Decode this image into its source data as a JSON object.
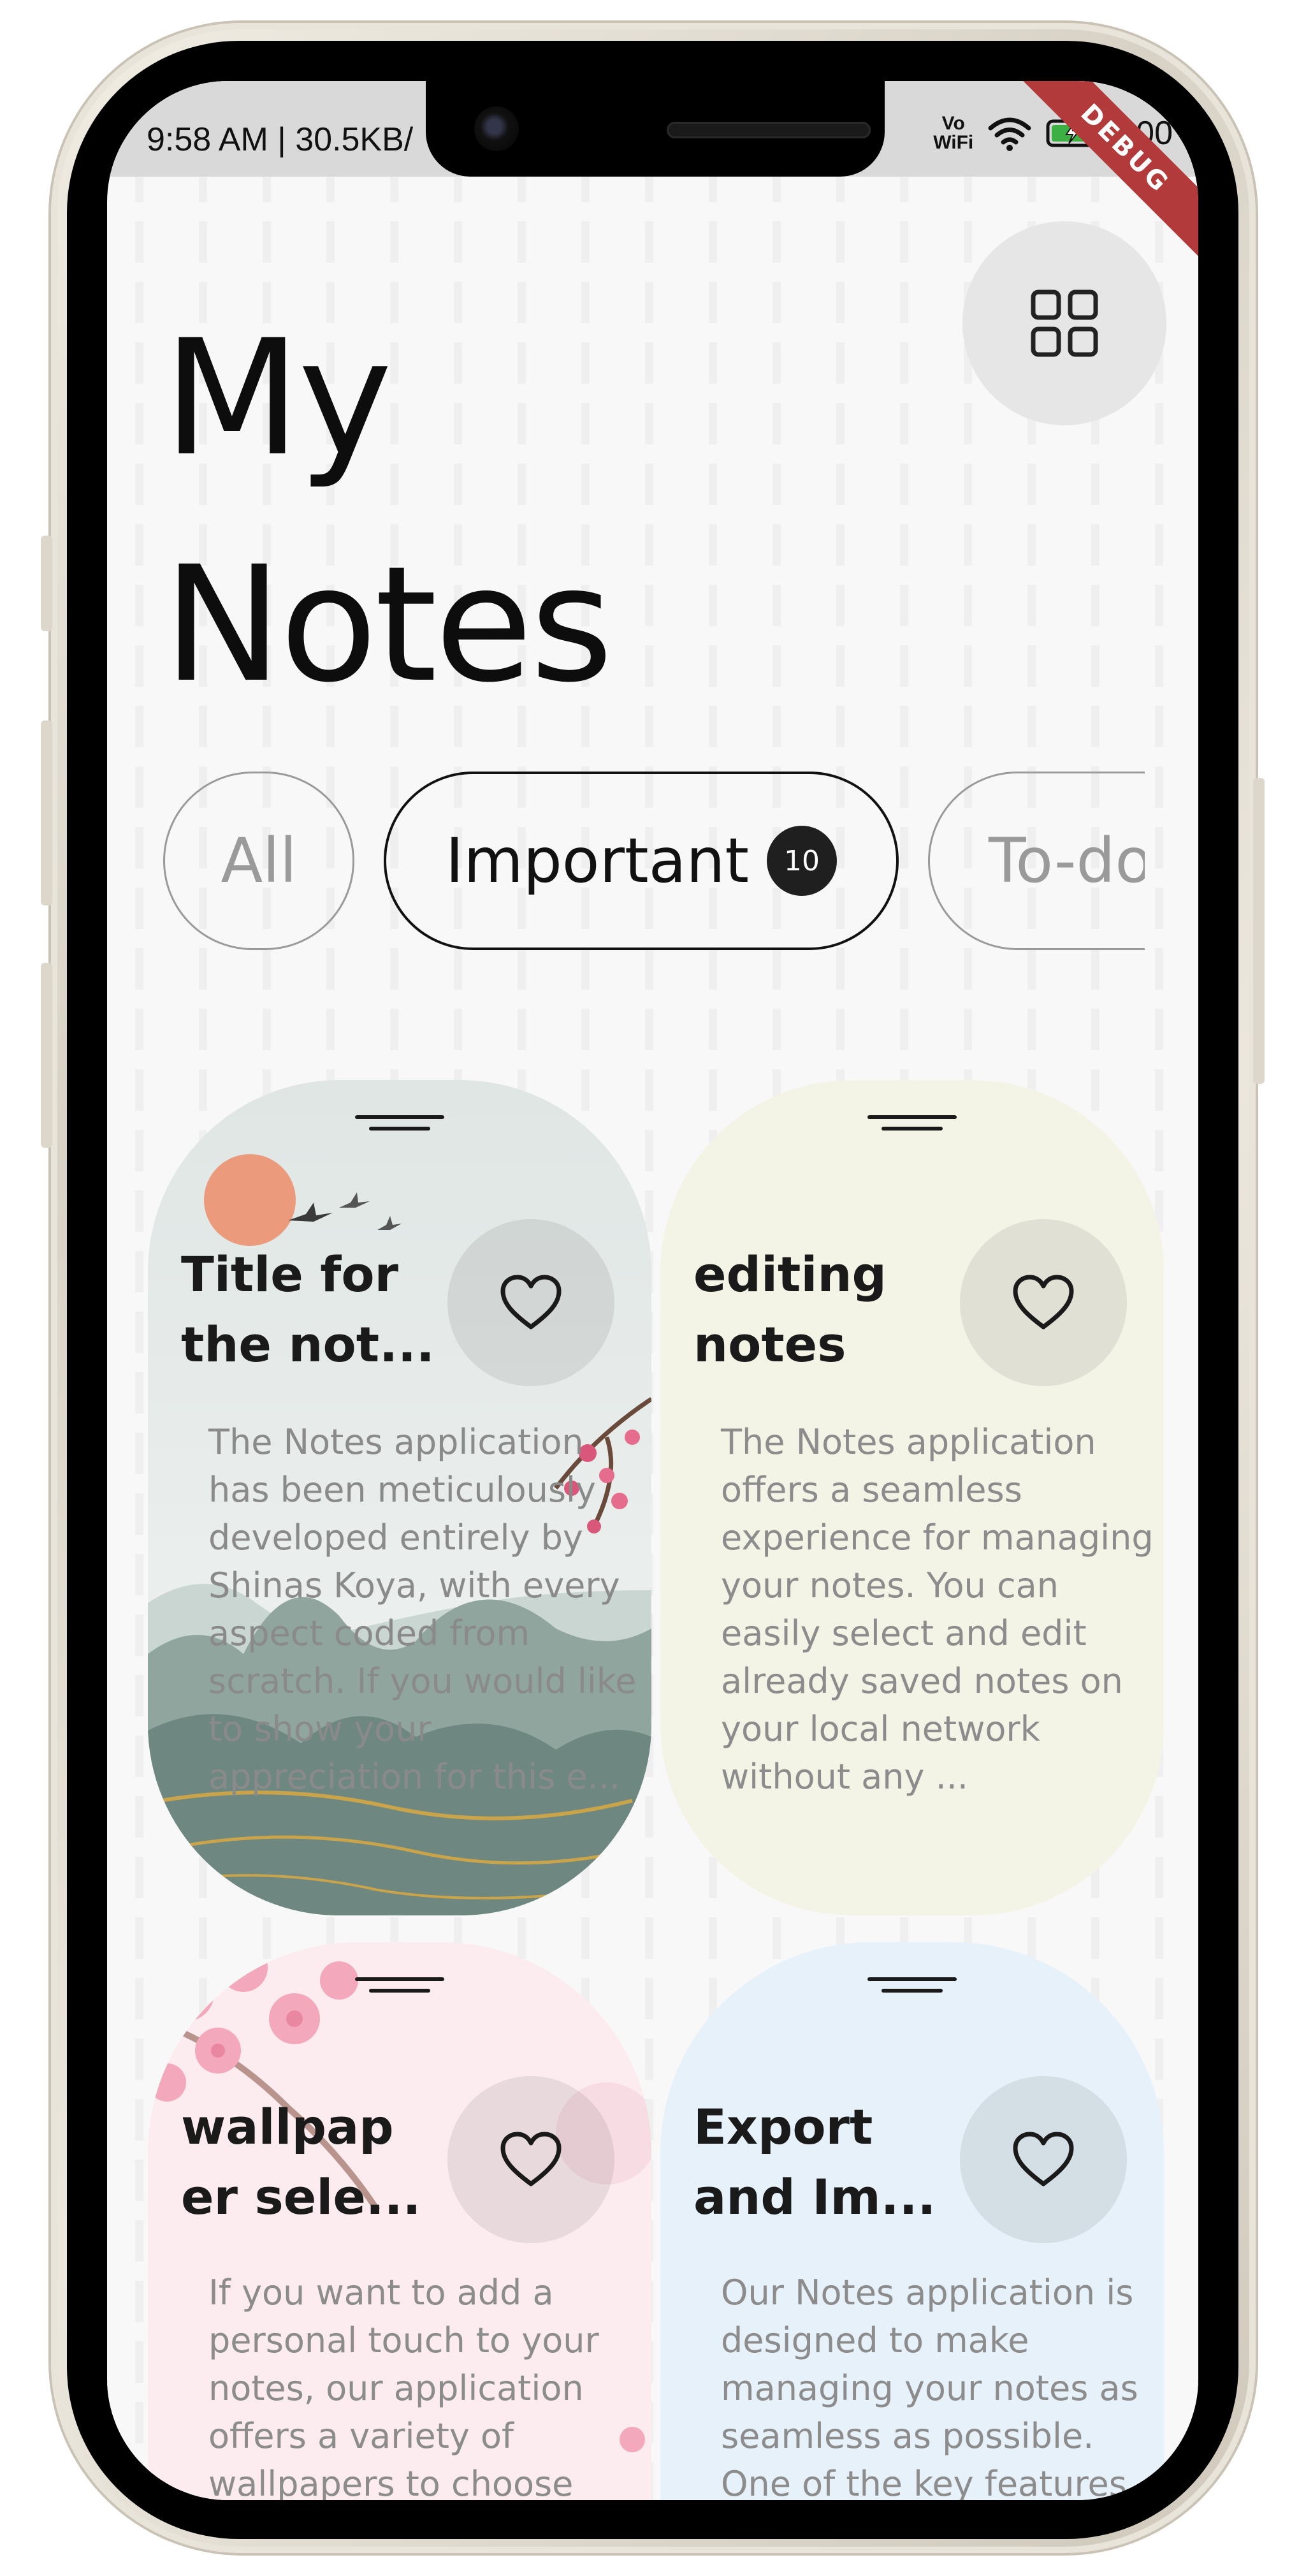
{
  "status_bar": {
    "time_info": "9:58 AM | 30.5KB/",
    "vowifi_line1": "Vo",
    "vowifi_line2": "WiFi",
    "battery": "100",
    "debug_label": "DEBUG"
  },
  "header": {
    "title": "My Notes",
    "layout_button_icon": "grid-icon"
  },
  "filters": [
    {
      "label": "All",
      "active": false
    },
    {
      "label": "Important",
      "active": true,
      "count": "10"
    },
    {
      "label": "To-do",
      "active": false
    }
  ],
  "notes": [
    {
      "title": "Title for the not...",
      "body": "The Notes application has been meticulously developed entirely by Shinas Koya, with every aspect coded from scratch. If you would like to show your appreciation for this e...",
      "background": "landscape-wallpaper",
      "bg_color": "#e7ecea"
    },
    {
      "title": "editing notes",
      "body": "The Notes application offers a seamless experience for managing your notes. You can easily select and edit already saved notes on your local network without any ...",
      "background": "plain",
      "bg_color": "#f4f4e6"
    },
    {
      "title": "wallpap er sele...",
      "body": "If you want to add a personal touch to your notes, our application offers a variety of wallpapers to choose",
      "background": "cherry-blossom-wallpaper",
      "bg_color": "#fbe8ec"
    },
    {
      "title": "Export and Im...",
      "body": "Our Notes application is designed to make managing your notes as seamless as possible. One of the key features",
      "background": "plain",
      "bg_color": "#e6f1f9"
    }
  ]
}
